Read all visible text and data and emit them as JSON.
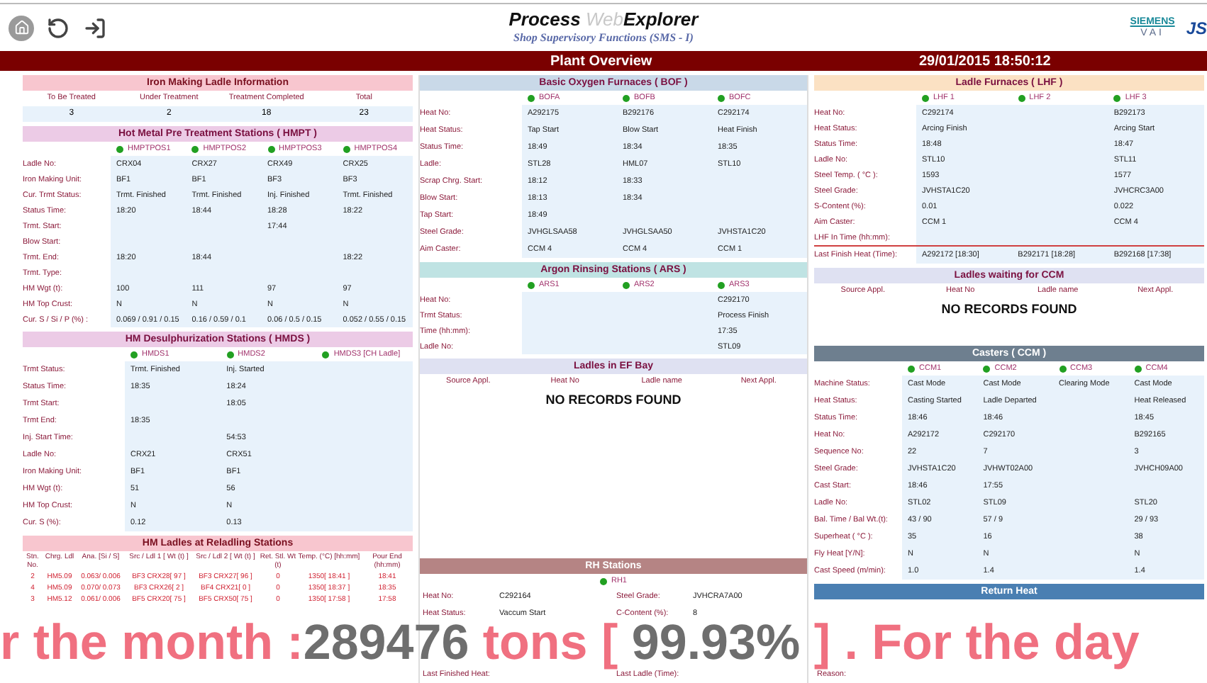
{
  "header": {
    "title_main": "Process ",
    "title_light": "Web",
    "title_end": "Explorer",
    "subtitle": "Shop Supervisory Functions (SMS - I)",
    "logo_top": "SIEMENS",
    "logo_bottom": "VAI",
    "logo_partner": "JS"
  },
  "title_bar": {
    "title": "Plant Overview",
    "datetime": "29/01/2015 18:50:12"
  },
  "iron_making": {
    "title": "Iron Making Ladle Information",
    "columns": [
      "To Be Treated",
      "Under Treatment",
      "Treatment Completed",
      "Total"
    ],
    "values": [
      "3",
      "2",
      "18",
      "23"
    ]
  },
  "hmpt": {
    "title": "Hot Metal Pre Treatment Stations ( HMPT )",
    "stations": [
      {
        "name": "HMPTPOS1",
        "color": "#22a022"
      },
      {
        "name": "HMPTPOS2",
        "color": "#22a022"
      },
      {
        "name": "HMPTPOS3",
        "color": "#22a022"
      },
      {
        "name": "HMPTPOS4",
        "color": "#22a022"
      }
    ],
    "rows": [
      {
        "label": "Ladle No:",
        "values": {
          "c1": "CRX04",
          "c2": "CRX27",
          "c3": "CRX49",
          "c4": "CRX25"
        }
      },
      {
        "label": "Iron Making Unit:",
        "values": {
          "c1": "BF1",
          "c2": "BF1",
          "c3": "BF3",
          "c4": "BF3"
        }
      },
      {
        "label": "Cur. Trmt Status:",
        "values": {
          "c1": "Trmt. Finished",
          "c2": "Trmt. Finished",
          "c3": "Inj. Finished",
          "c4": "Trmt. Finished"
        }
      },
      {
        "label": "Status Time:",
        "values": {
          "c1": "18:20",
          "c2": "18:44",
          "c3": "18:28",
          "c4": "18:22"
        }
      },
      {
        "label": "Trmt. Start:",
        "values": {
          "c3": "17:44"
        }
      },
      {
        "label": "Blow Start:",
        "values": {}
      },
      {
        "label": "Trmt. End:",
        "values": {
          "c1": "18:20",
          "c2": "18:44",
          "c4": "18:22"
        }
      },
      {
        "label": "Trmt. Type:",
        "values": {}
      },
      {
        "label": "HM Wgt (t):",
        "values": {
          "c1": "100",
          "c2": "111",
          "c3": "97",
          "c4": "97"
        }
      },
      {
        "label": "HM Top Crust:",
        "values": {
          "c1": "N",
          "c2": "N",
          "c3": "N",
          "c4": "N"
        }
      },
      {
        "label": "Cur. S / Si / P (%) :",
        "values": {
          "c1": "0.069 / 0.91 / 0.15",
          "c2": "0.16 / 0.59 / 0.1",
          "c3": "0.06 / 0.5 / 0.15",
          "c4": "0.052 / 0.55 / 0.15"
        }
      }
    ]
  },
  "hmds": {
    "title": "HM Desulphurization Stations ( HMDS )",
    "stations": [
      {
        "name": "HMDS1",
        "color": "#22a022"
      },
      {
        "name": "HMDS2",
        "color": "#22a022"
      },
      {
        "name": "HMDS3 [CH Ladle]",
        "color": "#22a022"
      }
    ],
    "rows": [
      {
        "label": "Trmt Status:",
        "values": {
          "c1": "Trmt. Finished",
          "c2": "Inj. Started"
        }
      },
      {
        "label": "Status Time:",
        "values": {
          "c1": "18:35",
          "c2": "18:24"
        }
      },
      {
        "label": "Trmt Start:",
        "values": {
          "c2": "18:05"
        }
      },
      {
        "label": "Trmt End:",
        "values": {
          "c1": "18:35"
        }
      },
      {
        "label": "Inj. Start Time:",
        "values": {
          "c2": "54:53"
        }
      },
      {
        "label": "Ladle No:",
        "values": {
          "c1": "CRX21",
          "c2": "CRX51"
        }
      },
      {
        "label": "Iron Making Unit:",
        "values": {
          "c1": "BF1",
          "c2": "BF1"
        }
      },
      {
        "label": "HM Wgt (t):",
        "values": {
          "c1": "51",
          "c2": "56"
        }
      },
      {
        "label": "HM Top Crust:",
        "values": {
          "c1": "N",
          "c2": "N"
        }
      },
      {
        "label": "Cur. S (%):",
        "values": {
          "c1": "0.12",
          "c2": "0.13"
        }
      }
    ]
  },
  "reladling": {
    "title": "HM Ladles at Reladling Stations",
    "columns": [
      "Stn. No.",
      "Chrg. Ldl",
      "Ana. [Si / S]",
      "Src / Ldl 1 [ Wt (t) ]",
      "Src / Ldl 2 [ Wt (t) ]",
      "Ret. Stl. Wt (t)",
      "Temp. (°C) [hh:mm]",
      "Pour End (hh:mm)"
    ],
    "rows": [
      [
        "2",
        "HM5.09",
        "0.063/ 0.006",
        "BF3 CRX28[ 97 ]",
        "BF3 CRX27[ 96 ]",
        "0",
        "1350[ 18:41 ]",
        "18:41"
      ],
      [
        "4",
        "HM5.09",
        "0.070/ 0.073",
        "BF3 CRX26[ 2 ]",
        "BF4 CRX21[ 0 ]",
        "0",
        "1350[ 18:37 ]",
        "18:35"
      ],
      [
        "3",
        "HM5.12",
        "0.061/ 0.006",
        "BF5 CRX20[ 75 ]",
        "BF5 CRX50[ 75 ]",
        "0",
        "1350[ 17:58 ]",
        "17:58"
      ]
    ]
  },
  "bof": {
    "title": "Basic Oxygen Furnaces ( BOF )",
    "stations": [
      {
        "name": "BOFA",
        "color": "#22a022"
      },
      {
        "name": "BOFB",
        "color": "#22a022"
      },
      {
        "name": "BOFC",
        "color": "#22a022"
      }
    ],
    "rows": [
      {
        "label": "Heat No:",
        "values": {
          "c1": "A292175",
          "c2": "B292176",
          "c3": "C292174"
        }
      },
      {
        "label": "Heat Status:",
        "values": {
          "c1": "Tap Start",
          "c2": "Blow Start",
          "c3": "Heat Finish"
        }
      },
      {
        "label": "Status Time:",
        "values": {
          "c1": "18:49",
          "c2": "18:34",
          "c3": "18:35"
        }
      },
      {
        "label": "Ladle:",
        "values": {
          "c1": "STL28",
          "c2": "HML07",
          "c3": "STL10"
        }
      },
      {
        "label": "Scrap Chrg. Start:",
        "values": {
          "c1": "18:12",
          "c2": "18:33"
        }
      },
      {
        "label": "Blow Start:",
        "values": {
          "c1": "18:13",
          "c2": "18:34"
        }
      },
      {
        "label": "Tap Start:",
        "values": {
          "c1": "18:49"
        }
      },
      {
        "label": "Steel Grade:",
        "values": {
          "c1": "JVHGLSAA58",
          "c2": "JVHGLSAA50",
          "c3": "JVHSTA1C20"
        }
      },
      {
        "label": "Aim Caster:",
        "values": {
          "c1": "CCM 4",
          "c2": "CCM 4",
          "c3": "CCM 1"
        }
      }
    ]
  },
  "ars": {
    "title": "Argon Rinsing Stations ( ARS )",
    "stations": [
      {
        "name": "ARS1",
        "color": "#22a022"
      },
      {
        "name": "ARS2",
        "color": "#22a022"
      },
      {
        "name": "ARS3",
        "color": "#22a022"
      }
    ],
    "rows": [
      {
        "label": "Heat No:",
        "values": {
          "c3": "C292170"
        }
      },
      {
        "label": "Trmt Status:",
        "values": {
          "c3": "Process Finish"
        }
      },
      {
        "label": "Time (hh:mm):",
        "values": {
          "c3": "17:35"
        }
      },
      {
        "label": "Ladle No:",
        "values": {
          "c3": "STL09"
        }
      }
    ]
  },
  "ef_bay": {
    "title": "Ladles in EF Bay",
    "columns": [
      "Source Appl.",
      "Heat No",
      "Ladle name",
      "Next Appl."
    ],
    "message": "NO RECORDS FOUND"
  },
  "rh": {
    "title": "RH Stations",
    "station": {
      "name": "RH1",
      "color": "#22a022"
    },
    "rows": [
      [
        {
          "label": "Heat No:",
          "value": "C292164"
        },
        {
          "label": "Steel Grade:",
          "value": "JVHCRA7A00"
        }
      ],
      [
        {
          "label": "Heat Status:",
          "value": "Vaccum Start"
        },
        {
          "label": "C-Content (%):",
          "value": "8"
        }
      ]
    ],
    "footer": [
      [
        {
          "label": "Last Finished Heat:"
        },
        {
          "label": "Last Ladle (Time):"
        }
      ]
    ]
  },
  "lhf": {
    "title": "Ladle Furnaces ( LHF )",
    "stations": [
      {
        "name": "LHF 1",
        "color": "#22a022"
      },
      {
        "name": "LHF 2",
        "color": "#22a022"
      },
      {
        "name": "LHF 3",
        "color": "#22a022"
      }
    ],
    "rows": [
      {
        "label": "Heat No:",
        "values": {
          "c1": "C292174",
          "c3": "B292173"
        }
      },
      {
        "label": "Heat Status:",
        "values": {
          "c1": "Arcing Finish",
          "c3": "Arcing Start"
        }
      },
      {
        "label": "Status Time:",
        "values": {
          "c1": "18:48",
          "c3": "18:47"
        }
      },
      {
        "label": "Ladle No:",
        "values": {
          "c1": "STL10",
          "c3": "STL11"
        }
      },
      {
        "label": "Steel Temp. ( °C ):",
        "values": {
          "c1": "1593",
          "c3": "1577"
        }
      },
      {
        "label": "Steel Grade:",
        "values": {
          "c1": "JVHSTA1C20",
          "c3": "JVHCRC3A00"
        }
      },
      {
        "label": "S-Content (%):",
        "values": {
          "c1": "0.01",
          "c3": "0.022"
        }
      },
      {
        "label": "Aim Caster:",
        "values": {
          "c1": "CCM 1",
          "c3": "CCM 4"
        }
      },
      {
        "label": "LHF In Time (hh:mm):",
        "values": {}
      }
    ],
    "last_finish": {
      "label": "Last Finish Heat (Time):",
      "values": [
        "A292172 [18:30]",
        "B292171 [18:28]",
        "B292168 [17:38]"
      ]
    }
  },
  "waiting_ccm": {
    "title": "Ladles waiting for CCM",
    "columns": [
      "Source Appl.",
      "Heat No",
      "Ladle name",
      "Next Appl."
    ],
    "message": "NO RECORDS FOUND"
  },
  "casters": {
    "title": "Casters ( CCM )",
    "stations": [
      {
        "name": "CCM1",
        "color": "#22a022"
      },
      {
        "name": "CCM2",
        "color": "#22a022"
      },
      {
        "name": "CCM3",
        "color": "#22a022"
      },
      {
        "name": "CCM4",
        "color": "#22a022"
      }
    ],
    "rows": [
      {
        "label": "Machine Status:",
        "values": {
          "c1": "Cast Mode",
          "c2": "Cast Mode",
          "c3": "Clearing Mode",
          "c4": "Cast Mode"
        }
      },
      {
        "label": "Heat Status:",
        "values": {
          "c1": "Casting Started",
          "c2": "Ladle Departed",
          "c4": "Heat Released"
        }
      },
      {
        "label": "Status Time:",
        "values": {
          "c1": "18:46",
          "c2": "18:46",
          "c4": "18:45"
        }
      },
      {
        "label": "Heat No:",
        "values": {
          "c1": "A292172",
          "c2": "C292170",
          "c4": "B292165"
        }
      },
      {
        "label": "Sequence No:",
        "values": {
          "c1": "22",
          "c2": "7",
          "c4": "3"
        }
      },
      {
        "label": "Steel Grade:",
        "values": {
          "c1": "JVHSTA1C20",
          "c2": "JVHWT02A00",
          "c4": "JVHCH09A00"
        }
      },
      {
        "label": "Cast Start:",
        "values": {
          "c1": "18:46",
          "c2": "17:55"
        }
      },
      {
        "label": "Ladle No:",
        "values": {
          "c1": "STL02",
          "c2": "STL09",
          "c4": "STL20"
        }
      },
      {
        "label": "Bal. Time / Bal Wt.(t):",
        "values": {
          "c1": "43 / 90",
          "c2": "57 / 9",
          "c4": "29 / 93"
        }
      },
      {
        "label": "Superheat ( °C ):",
        "values": {
          "c1": "35",
          "c2": "16",
          "c4": "38"
        }
      },
      {
        "label": "Fly Heat [Y/N]:",
        "values": {
          "c1": "N",
          "c2": "N",
          "c4": "N"
        }
      },
      {
        "label": "Cast Speed (m/min):",
        "values": {
          "c1": "1.0",
          "c2": "1.4",
          "c4": "1.4"
        }
      }
    ]
  },
  "return_heat": {
    "title": "Return Heat",
    "footer": [
      [
        {
          "label": "Reason:"
        }
      ]
    ]
  },
  "ticker": [
    {
      "kind": "label",
      "text": "r the month :"
    },
    {
      "kind": "value",
      "text": "289476"
    },
    {
      "kind": "label",
      "text": " tons [ "
    },
    {
      "kind": "value",
      "text": "99.93%"
    },
    {
      "kind": "label",
      "text": " ] . For the day"
    }
  ]
}
